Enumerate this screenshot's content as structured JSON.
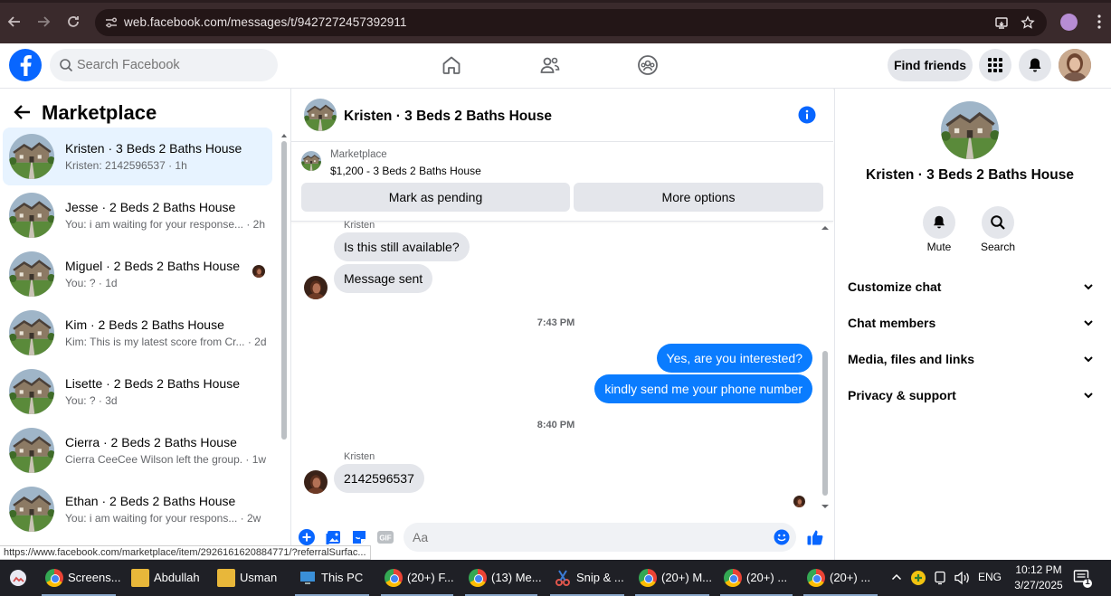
{
  "browser": {
    "url_host": "web.facebook.com",
    "url_path": "/messages/t/9427272457392911"
  },
  "fb": {
    "search_placeholder": "Search Facebook",
    "find_friends": "Find friends"
  },
  "sidebar": {
    "title": "Marketplace",
    "conversations": [
      {
        "name": "Kristen · 3 Beds 2 Baths House",
        "snippet": "Kristen: 2142596537 · 1h",
        "active": true
      },
      {
        "name": "Jesse · 2 Beds 2 Baths House",
        "snippet": "You: i am waiting for your response... · 2h"
      },
      {
        "name": "Miguel · 2 Beds 2 Baths House",
        "snippet": "You: ? · 1d"
      },
      {
        "name": "Kim · 2 Beds 2 Baths House",
        "snippet": "Kim: This is my latest score from Cr... · 2d"
      },
      {
        "name": "Lisette · 2 Beds 2 Baths House",
        "snippet": "You: ? · 3d"
      },
      {
        "name": "Cierra · 2 Beds 2 Baths House",
        "snippet": "Cierra CeeCee Wilson left the group. · 1w"
      },
      {
        "name": "Ethan · 2 Beds 2 Baths House",
        "snippet": "You: i am waiting for your respons... · 2w"
      }
    ]
  },
  "chat": {
    "title": "Kristen · 3 Beds 2 Baths House",
    "listing_source": "Marketplace",
    "listing_price": "$1,200 - 3 Beds 2 Baths House",
    "mark_pending": "Mark as pending",
    "more_options": "More options",
    "messages": {
      "sender1": "Kristen",
      "m1": "Is this still available?",
      "m2": "Message sent",
      "time1": "7:43 PM",
      "m3": "Yes, are you interested?",
      "m4": "kindly send me your phone number",
      "time2": "8:40 PM",
      "sender2": "Kristen",
      "m5": "2142596537"
    },
    "composer_placeholder": "Aa"
  },
  "details": {
    "title": "Kristen · 3 Beds 2 Baths House",
    "mute": "Mute",
    "search": "Search",
    "sections": [
      "Customize chat",
      "Chat members",
      "Media, files and links",
      "Privacy & support"
    ]
  },
  "status_url": "https://www.facebook.com/marketplace/item/2926161620884771/?referralSurfac...",
  "taskbar": {
    "items": [
      "Screens...",
      "Abdullah",
      "Usman",
      "This PC",
      "(20+) F...",
      "(13) Me...",
      "Snip & ...",
      "(20+) M...",
      "(20+) ...",
      "(20+) ..."
    ],
    "lang": "ENG",
    "time": "10:12 PM",
    "date": "3/27/2025",
    "notif_count": "1"
  }
}
